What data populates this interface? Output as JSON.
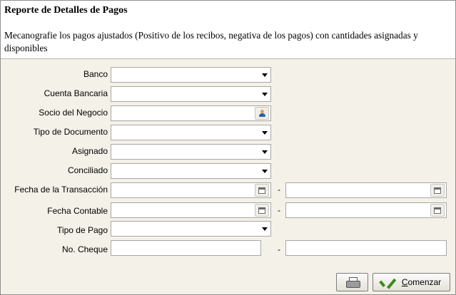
{
  "header": {
    "title": "Reporte de Detalles de Pagos",
    "description": "Mecanografie los pagos ajustados (Positivo de los recibos, negativa de los pagos) con cantidades asignadas y disponibles"
  },
  "form": {
    "banco": {
      "label": "Banco",
      "value": ""
    },
    "cuenta_bancaria": {
      "label": "Cuenta Bancaria",
      "value": ""
    },
    "socio_negocio": {
      "label": "Socio del Negocio",
      "value": ""
    },
    "tipo_documento": {
      "label": "Tipo de Documento",
      "value": ""
    },
    "asignado": {
      "label": "Asignado",
      "value": ""
    },
    "conciliado": {
      "label": "Conciliado",
      "value": ""
    },
    "fecha_transaccion": {
      "label": "Fecha de la Transacción",
      "from": "",
      "to": "",
      "separator": "-"
    },
    "fecha_contable": {
      "label": "Fecha Contable",
      "from": "",
      "to": "",
      "separator": "-"
    },
    "tipo_pago": {
      "label": "Tipo de Pago",
      "value": ""
    },
    "no_cheque": {
      "label": "No. Cheque",
      "from": "",
      "to": "",
      "separator": "-"
    }
  },
  "buttons": {
    "print_icon": "printer-icon",
    "start_label_underlined": "C",
    "start_label_rest": "omenzar",
    "start_icon": "checkmark-icon"
  }
}
